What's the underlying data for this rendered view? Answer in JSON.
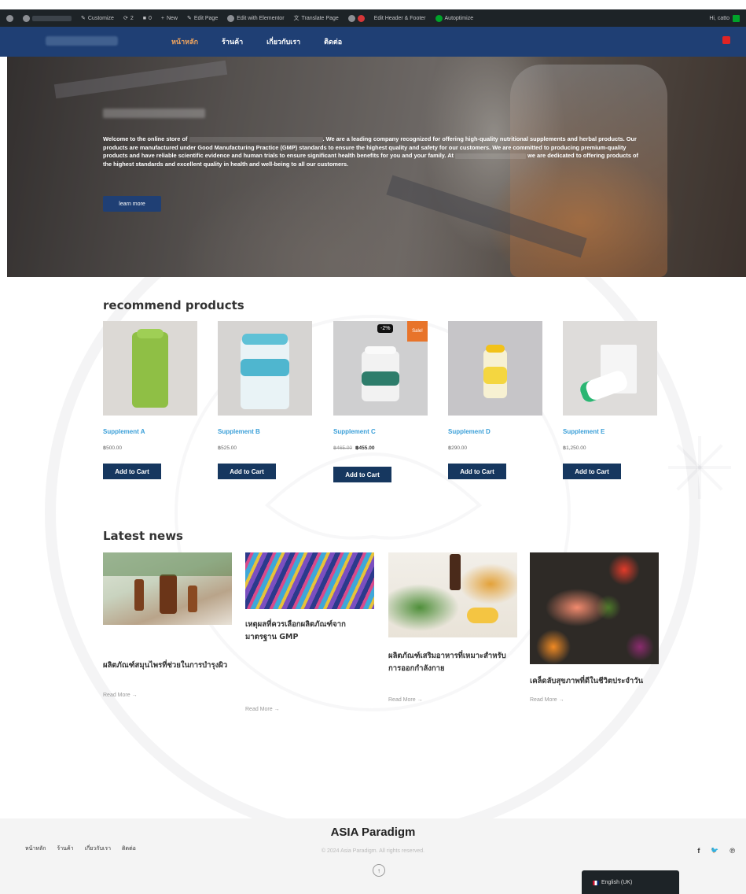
{
  "adminbar": {
    "customize": "Customize",
    "updates": "2",
    "comments": "0",
    "new": "New",
    "edit_page": "Edit Page",
    "edit_elementor": "Edit with Elementor",
    "translate": "Translate Page",
    "header_footer": "Edit Header & Footer",
    "autoptimize": "Autoptimize",
    "howdy": "Hi, catto"
  },
  "nav": {
    "items": [
      "หน้าหลัก",
      "ร้านค้า",
      "เกี่ยวกับเรา",
      "ติดต่อ"
    ]
  },
  "hero": {
    "text_1": "Welcome to the online store of",
    "text_2": ". We are a leading company recognized for offering high-quality nutritional supplements and herbal products. Our products are manufactured under Good Manufacturing Practice (GMP) standards to ensure the highest quality and safety for our customers. We are committed to producing premium-quality products and have reliable scientific evidence and human trials to ensure significant health benefits for you and your family. At",
    "text_3": "we are dedicated to offering products of the highest standards and excellent quality in health and well-being to all our customers.",
    "button": "learn more"
  },
  "products": {
    "title": "recommend products",
    "add_to_cart": "Add to Cart",
    "items": [
      {
        "name": "Supplement A",
        "price": "฿500.00",
        "old_price": ""
      },
      {
        "name": "Supplement B",
        "price": "฿525.00",
        "old_price": ""
      },
      {
        "name": "Supplement C",
        "price": "฿455.00",
        "old_price": "฿465.00",
        "discount": "-2%",
        "sale": "Sale!"
      },
      {
        "name": "Supplement D",
        "price": "฿290.00",
        "old_price": ""
      },
      {
        "name": "Supplement E",
        "price": "฿1,250.00",
        "old_price": ""
      }
    ]
  },
  "news": {
    "title": "Latest news",
    "read_more": "Read More →",
    "items": [
      {
        "title": "ผลิตภัณฑ์สมุนไพรที่ช่วยในการบำรุงผิว"
      },
      {
        "title": "เหตุผลที่ควรเลือกผลิตภัณฑ์จากมาตรฐาน GMP"
      },
      {
        "title": "ผลิตภัณฑ์เสริมอาหารที่เหมาะสำหรับการออกกำลังกาย"
      },
      {
        "title": "เคล็ดลับสุขภาพที่ดีในชีวิตประจำวัน"
      }
    ]
  },
  "footer": {
    "brand": "ASIA Paradigm",
    "copyright": "© 2024 Asia Paradigm. All rights reserved.",
    "nav": [
      "หน้าหลัก",
      "ร้านค้า",
      "เกี่ยวกับเรา",
      "ติดต่อ"
    ],
    "social": [
      "f",
      "🐦",
      "℗"
    ],
    "to_top": "↑",
    "language": "English (UK)"
  },
  "colors": {
    "header": "#1f3f74",
    "nav_active": "#f0a45e",
    "button": "#16375f",
    "product_name": "#3a9fd8",
    "sale": "#e8742a"
  }
}
